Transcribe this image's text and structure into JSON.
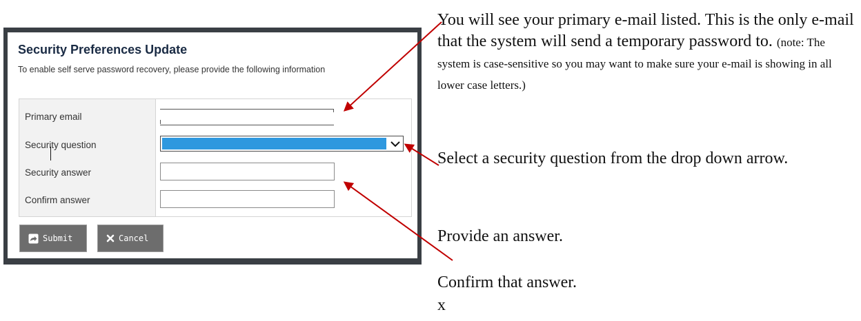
{
  "dialog": {
    "title": "Security Preferences Update",
    "subtitle": "To enable self serve password recovery, please provide the following information"
  },
  "form": {
    "email_label": "Primary email",
    "email_value": "",
    "question_label": "Security question",
    "question_value": "",
    "answer_label": "Security answer",
    "answer_value": "",
    "confirm_label": "Confirm answer",
    "confirm_value": ""
  },
  "buttons": {
    "submit_label": "Submit",
    "submit_icon": "share-arrow-icon",
    "cancel_label": "Cancel",
    "cancel_icon": "x-icon"
  },
  "annotations": {
    "email_main": "You will see your primary e-mail listed. This is the only e-mail that the system will send a temporary password to.",
    "email_note": "(note: The system is case-sensitive so you may want to make sure your e-mail is showing in all lower case letters.)",
    "question": "Select a security question from the drop down arrow.",
    "answer": "Provide an answer.",
    "confirm": "Confirm that answer.",
    "trailing_mark": "x"
  },
  "colors": {
    "arrow": "#c00000",
    "select_highlight": "#2e98df",
    "frame": "#3a3f44",
    "button": "#6d6d6d"
  }
}
